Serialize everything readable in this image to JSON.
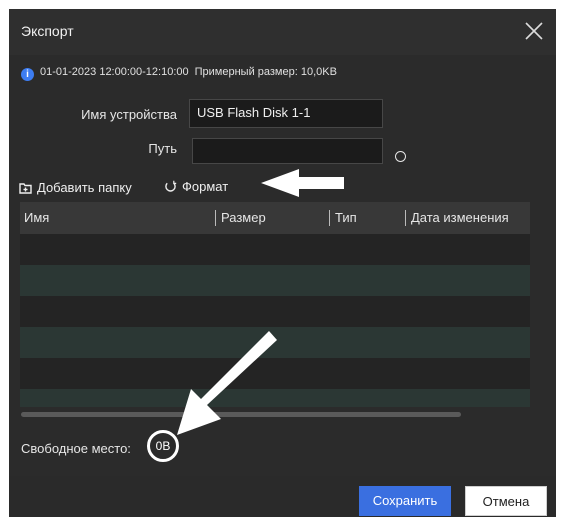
{
  "dialog": {
    "title": "Экспорт",
    "close_icon": "close-icon"
  },
  "info": {
    "icon": "info-icon",
    "icon_glyph": "i",
    "time_range": "01-01-2023 12:00:00-12:10:00",
    "size_text": "Примерный размер: 10,0KB"
  },
  "device": {
    "label": "Имя устройства",
    "value": "USB Flash Disk 1-1"
  },
  "path": {
    "label": "Путь",
    "value": "",
    "loading_icon": "spinner-icon"
  },
  "toolbar": {
    "add_folder_label": "Добавить папку",
    "add_folder_icon": "folder-add-icon",
    "format_label": "Формат",
    "format_icon": "refresh-icon"
  },
  "table": {
    "columns": [
      "Имя",
      "Размер",
      "Тип",
      "Дата изменения"
    ],
    "rows": []
  },
  "free_space": {
    "label": "Свободное место:",
    "value": "0B"
  },
  "footer": {
    "save_label": "Сохранить",
    "cancel_label": "Отмена"
  },
  "colors": {
    "accent": "#3a6fe0",
    "info": "#3d7df2",
    "dialog_bg": "#2b2b2b",
    "annotation_arrow": "#ffffff"
  }
}
